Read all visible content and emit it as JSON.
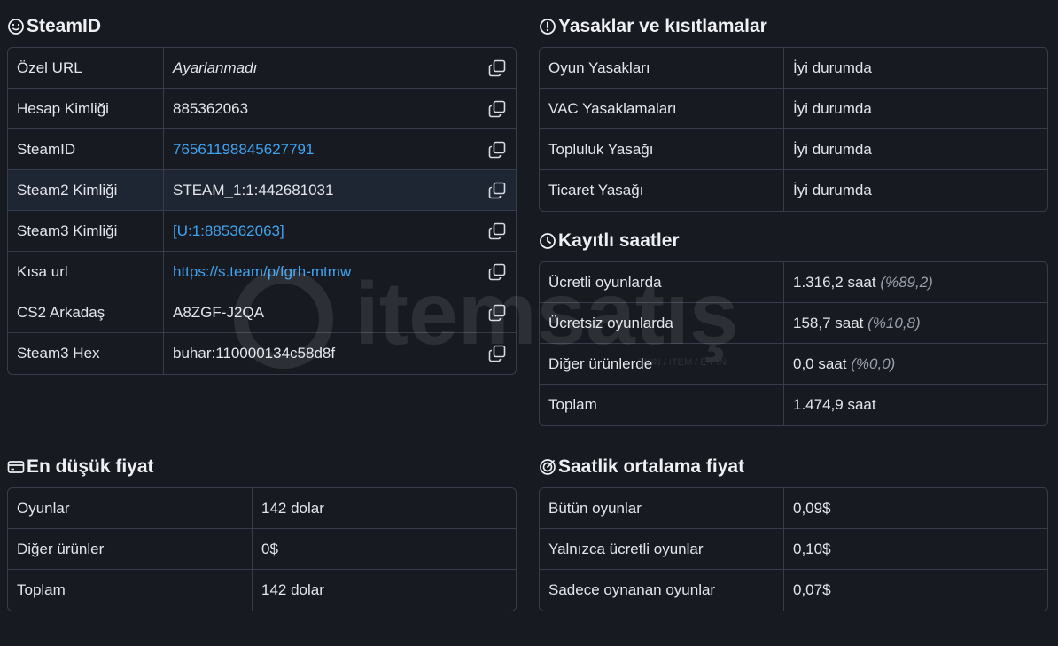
{
  "steamid": {
    "title": "SteamID",
    "rows": [
      {
        "label": "Özel URL",
        "value": "Ayarlanmadı"
      },
      {
        "label": "Hesap Kimliği",
        "value": "885362063"
      },
      {
        "label": "SteamID",
        "value": "76561198845627791"
      },
      {
        "label": "Steam2 Kimliği",
        "value": "STEAM_1:1:442681031"
      },
      {
        "label": "Steam3 Kimliği",
        "value": "[U:1:885362063]"
      },
      {
        "label": "Kısa url",
        "value": "https://s.team/p/fgrh-mtmw"
      },
      {
        "label": "CS2 Arkadaş",
        "value": "A8ZGF-J2QA"
      },
      {
        "label": "Steam3 Hex",
        "value": "buhar:110000134c58d8f"
      }
    ]
  },
  "bans": {
    "title": "Yasaklar ve kısıtlamalar",
    "rows": [
      {
        "label": "Oyun Yasakları",
        "value": "İyi durumda"
      },
      {
        "label": "VAC Yasaklamaları",
        "value": "İyi durumda"
      },
      {
        "label": "Topluluk Yasağı",
        "value": "İyi durumda"
      },
      {
        "label": "Ticaret Yasağı",
        "value": "İyi durumda"
      }
    ]
  },
  "hours": {
    "title": "Kayıtlı saatler",
    "rows": [
      {
        "label": "Ücretli oyunlarda",
        "value": "1.316,2 saat",
        "pct": "(%89,2)"
      },
      {
        "label": "Ücretsiz oyunlarda",
        "value": "158,7 saat",
        "pct": "(%10,8)"
      },
      {
        "label": "Diğer ürünlerde",
        "value": "0,0 saat",
        "pct": "(%0,0)"
      },
      {
        "label": "Toplam",
        "value": "1.474,9 saat",
        "pct": ""
      }
    ]
  },
  "lowest_price": {
    "title": "En düşük fiyat",
    "rows": [
      {
        "label": "Oyunlar",
        "value": "142 dolar"
      },
      {
        "label": "Diğer ürünler",
        "value": "0$"
      },
      {
        "label": "Toplam",
        "value": "142 dolar"
      }
    ]
  },
  "hourly_price": {
    "title": "Saatlik ortalama fiyat",
    "rows": [
      {
        "label": "Bütün oyunlar",
        "value": "0,09$"
      },
      {
        "label": "Yalnızca ücretli oyunlar",
        "value": "0,10$"
      },
      {
        "label": "Sadece oynanan oyunlar",
        "value": "0,07$"
      }
    ]
  },
  "watermark": {
    "brand": "itemsatış",
    "tagline": "SKIN / ITEM / E-PIN"
  },
  "colors": {
    "background": "#171a21",
    "link": "#3ea3f0",
    "border": "#363c49"
  }
}
